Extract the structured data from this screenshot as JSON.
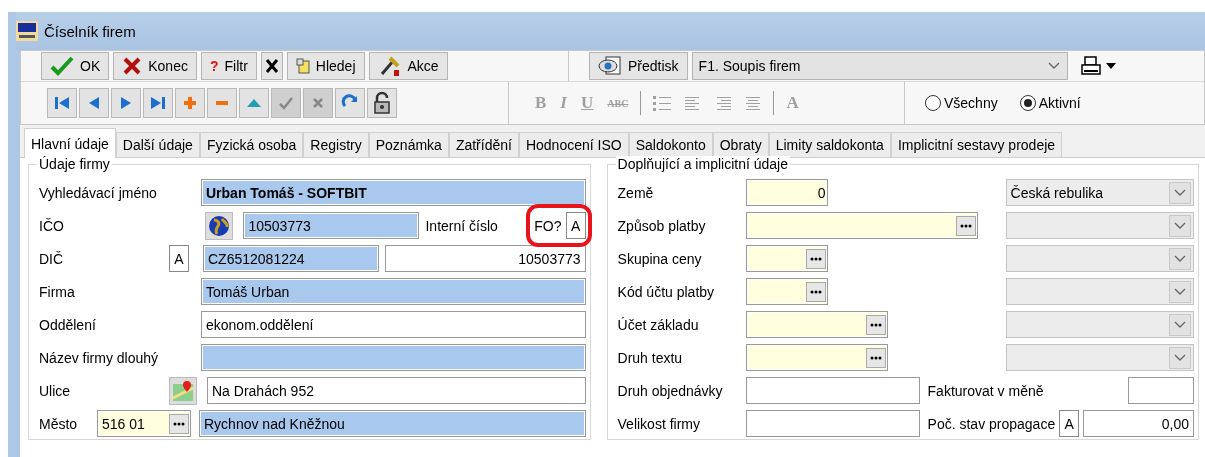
{
  "window": {
    "title": "Číselník firem"
  },
  "toolbar": {
    "buttons": [
      {
        "kind": "ok",
        "label": "OK"
      },
      {
        "kind": "close",
        "label": "Konec"
      },
      {
        "kind": "filter",
        "icon_text": "?",
        "label": "Filtr"
      },
      {
        "kind": "clear-filter"
      },
      {
        "kind": "search",
        "label": "Hledej"
      },
      {
        "kind": "actions",
        "label": "Akce"
      }
    ],
    "print": {
      "button": "Předtisk",
      "report": "F1. Soupis firem"
    }
  },
  "nav_buttons": [
    {
      "kind": "first",
      "disabled": false
    },
    {
      "kind": "prev",
      "disabled": false
    },
    {
      "kind": "next",
      "disabled": false
    },
    {
      "kind": "last",
      "disabled": false
    },
    {
      "kind": "add",
      "disabled": false
    },
    {
      "kind": "delete",
      "disabled": false
    },
    {
      "kind": "up",
      "disabled": false
    },
    {
      "kind": "confirm",
      "disabled": true
    },
    {
      "kind": "cancel",
      "disabled": true
    },
    {
      "kind": "refresh",
      "disabled": false
    },
    {
      "kind": "lock",
      "disabled": false
    }
  ],
  "format_tools": [
    {
      "kind": "bold",
      "label": "B",
      "disabled": true
    },
    {
      "kind": "italic",
      "label": "I",
      "disabled": true
    },
    {
      "kind": "underline",
      "label": "U",
      "disabled": true
    },
    {
      "kind": "strike",
      "label": "ABC",
      "disabled": true
    },
    {
      "kind": "separator"
    },
    {
      "kind": "bullets",
      "disabled": true
    },
    {
      "kind": "align-left",
      "disabled": true
    },
    {
      "kind": "align-right",
      "disabled": true
    },
    {
      "kind": "center",
      "disabled": true
    },
    {
      "kind": "separator"
    },
    {
      "kind": "font",
      "label": "A",
      "disabled": true
    }
  ],
  "record_filter": [
    {
      "label": "Všechny",
      "selected": false
    },
    {
      "label": "Aktivní",
      "selected": true
    }
  ],
  "tabs": [
    {
      "label": "Hlavní údaje",
      "selected": true
    },
    {
      "label": "Další údaje",
      "selected": false
    },
    {
      "label": "Fyzická osoba",
      "selected": false
    },
    {
      "label": "Registry",
      "selected": false
    },
    {
      "label": "Poznámka",
      "selected": false
    },
    {
      "label": "Zatřídění",
      "selected": false
    },
    {
      "label": "Hodnocení ISO",
      "selected": false
    },
    {
      "label": "Saldokonto",
      "selected": false
    },
    {
      "label": "Obraty",
      "selected": false
    },
    {
      "label": "Limity saldokonta",
      "selected": false
    },
    {
      "label": "Implicitní sestavy prodeje",
      "selected": false
    }
  ],
  "company": {
    "title": "Údaje firmy",
    "rows": [
      {
        "kind": "text",
        "label": "Vyhledávací jméno",
        "value": "Urban Tomáš - SOFTBIT",
        "required": true,
        "bold": true
      },
      {
        "kind": "ico",
        "label": "IČO",
        "value": "10503773",
        "required": true,
        "internal_label": "Interní číslo",
        "fo_label": "FO?",
        "fo_value": "A",
        "highlighted": true
      },
      {
        "kind": "dic",
        "label": "DIČ",
        "flag": "A",
        "value": "CZ6512081224",
        "required": true,
        "internal_value": "10503773"
      },
      {
        "kind": "text",
        "label": "Firma",
        "value": "Tomáš Urban",
        "required": true,
        "bold": false
      },
      {
        "kind": "text",
        "label": "Oddělení",
        "value": "ekonom.oddělení",
        "required": false,
        "bold": false
      },
      {
        "kind": "text",
        "label": "Název firmy dlouhý",
        "required": true,
        "bold": false
      },
      {
        "kind": "street",
        "label": "Ulice",
        "value": "Na Drahách 952",
        "required": false
      },
      {
        "kind": "city",
        "label": "Město",
        "zip": "516 01",
        "value": "Rychnov nad Kněžnou",
        "required": true
      }
    ]
  },
  "defaults": {
    "title": "Doplňující a implicitní údaje",
    "rows": [
      {
        "kind": "lookup",
        "label": "Země",
        "code": "0",
        "lookup_button": false,
        "combo": "Česká rebulika"
      },
      {
        "kind": "lookup",
        "label": "Způsob platby",
        "lookup_button": true
      },
      {
        "kind": "lookup",
        "label": "Skupina ceny",
        "lookup_button": true
      },
      {
        "kind": "lookup",
        "label": "Kód účtu platby",
        "lookup_button": true
      },
      {
        "kind": "lookup",
        "label": "Účet základu",
        "lookup_button": true
      },
      {
        "kind": "lookup",
        "label": "Druh textu",
        "lookup_button": true
      },
      {
        "kind": "pair",
        "label": "Druh objednávky",
        "label2": "Fakturovat v měně"
      },
      {
        "kind": "promo",
        "label": "Velikost firmy",
        "label2": "Poč. stav propagace",
        "flag": "A",
        "value2": "0,00"
      }
    ]
  }
}
